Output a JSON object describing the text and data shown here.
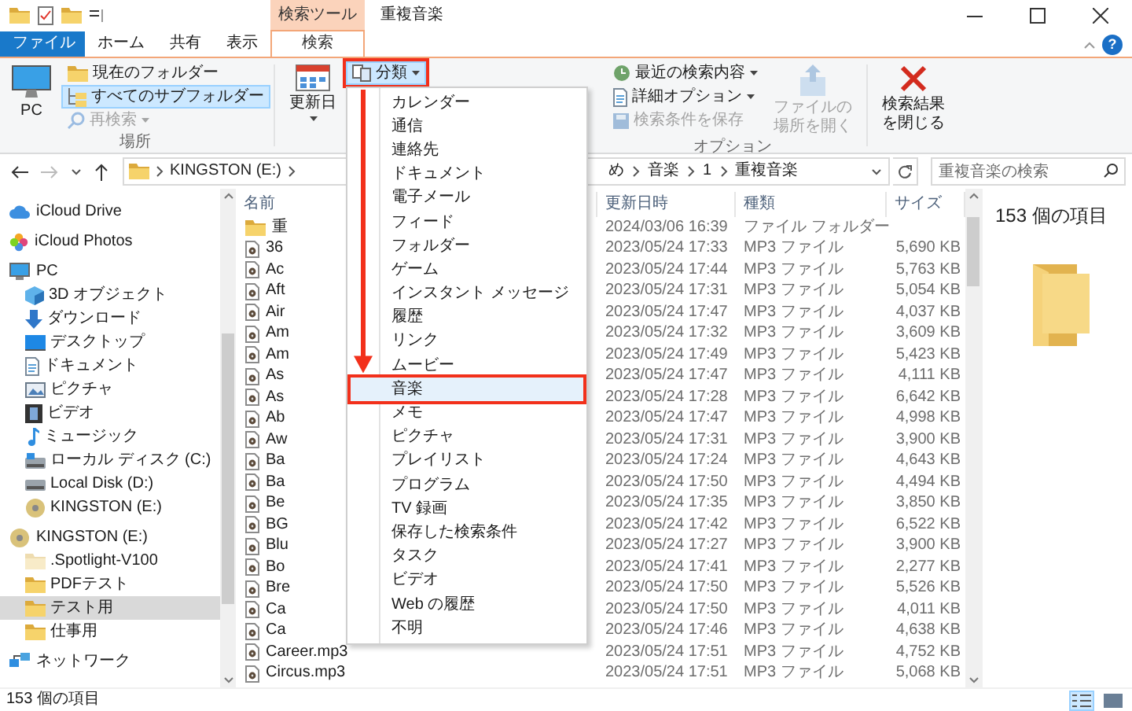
{
  "window": {
    "title": "重複音楽"
  },
  "contextual_tab_group": {
    "label": "検索ツール"
  },
  "tabs": [
    {
      "label": "ファイル",
      "kind": "file",
      "selected": false
    },
    {
      "label": "ホーム",
      "kind": "normal",
      "selected": false
    },
    {
      "label": "共有",
      "kind": "normal",
      "selected": false
    },
    {
      "label": "表示",
      "kind": "normal",
      "selected": false
    },
    {
      "label": "検索",
      "kind": "contextual",
      "selected": true
    }
  ],
  "help_button": {
    "label": "?"
  },
  "ribbon": {
    "location_group": {
      "label": "場所",
      "pc_button": {
        "label": "PC"
      },
      "buttons": [
        {
          "label": "現在のフォルダー",
          "selected": false,
          "disabled": false,
          "dropdown": false
        },
        {
          "label": "すべてのサブフォルダー",
          "selected": true,
          "disabled": false,
          "dropdown": false
        },
        {
          "label": "再検索",
          "selected": false,
          "disabled": true,
          "dropdown": true
        }
      ]
    },
    "date_button": {
      "label": "更新日"
    },
    "kind_button": {
      "label": "分類",
      "pressed": true,
      "highlighted": true
    },
    "options_group": {
      "label": "オプション",
      "buttons": [
        {
          "label": "最近の検索内容",
          "disabled": false,
          "dropdown": true
        },
        {
          "label": "詳細オプション",
          "disabled": false,
          "dropdown": true
        },
        {
          "label": "検索条件を保存",
          "disabled": true,
          "dropdown": false
        }
      ],
      "open_location": {
        "lines": [
          "ファイルの",
          "場所を開く"
        ],
        "disabled": true
      }
    },
    "close_search": {
      "lines": [
        "検索結果",
        "を閉じる"
      ],
      "disabled": false
    }
  },
  "kind_menu": {
    "items": [
      {
        "label": "カレンダー",
        "selected": false,
        "highlighted": false
      },
      {
        "label": "通信",
        "selected": false,
        "highlighted": false
      },
      {
        "label": "連絡先",
        "selected": false,
        "highlighted": false
      },
      {
        "label": "ドキュメント",
        "selected": false,
        "highlighted": false
      },
      {
        "label": "電子メール",
        "selected": false,
        "highlighted": false
      },
      {
        "label": "フィード",
        "selected": false,
        "highlighted": false
      },
      {
        "label": "フォルダー",
        "selected": false,
        "highlighted": false
      },
      {
        "label": "ゲーム",
        "selected": false,
        "highlighted": false
      },
      {
        "label": "インスタント メッセージ",
        "selected": false,
        "highlighted": false
      },
      {
        "label": "履歴",
        "selected": false,
        "highlighted": false
      },
      {
        "label": "リンク",
        "selected": false,
        "highlighted": false
      },
      {
        "label": "ムービー",
        "selected": false,
        "highlighted": false
      },
      {
        "label": "音楽",
        "selected": true,
        "highlighted": true
      },
      {
        "label": "メモ",
        "selected": false,
        "highlighted": false
      },
      {
        "label": "ピクチャ",
        "selected": false,
        "highlighted": false
      },
      {
        "label": "プレイリスト",
        "selected": false,
        "highlighted": false
      },
      {
        "label": "プログラム",
        "selected": false,
        "highlighted": false
      },
      {
        "label": "TV 録画",
        "selected": false,
        "highlighted": false
      },
      {
        "label": "保存した検索条件",
        "selected": false,
        "highlighted": false
      },
      {
        "label": "タスク",
        "selected": false,
        "highlighted": false
      },
      {
        "label": "ビデオ",
        "selected": false,
        "highlighted": false
      },
      {
        "label": "Web の履歴",
        "selected": false,
        "highlighted": false
      },
      {
        "label": "不明",
        "selected": false,
        "highlighted": false
      }
    ]
  },
  "address_bar": {
    "left_segments": [
      "KINGSTON (E:)"
    ],
    "right_segments": [
      "め",
      "音楽",
      "1",
      "重複音楽"
    ]
  },
  "search": {
    "placeholder": "重複音楽の検索"
  },
  "navigation": {
    "items": [
      {
        "label": "iCloud Drive",
        "kind": "cloud",
        "selected": false
      },
      {
        "label": "iCloud Photos",
        "kind": "photos",
        "selected": false
      },
      {
        "label": "PC",
        "kind": "pc",
        "selected": false,
        "children": [
          {
            "label": "3D オブジェクト",
            "kind": "cube",
            "selected": false
          },
          {
            "label": "ダウンロード",
            "kind": "download",
            "selected": false
          },
          {
            "label": "デスクトップ",
            "kind": "desktop",
            "selected": false
          },
          {
            "label": "ドキュメント",
            "kind": "document",
            "selected": false
          },
          {
            "label": "ピクチャ",
            "kind": "pictures",
            "selected": false
          },
          {
            "label": "ビデオ",
            "kind": "video",
            "selected": false
          },
          {
            "label": "ミュージック",
            "kind": "music",
            "selected": false
          },
          {
            "label": "ローカル ディスク (C:)",
            "kind": "system_drive",
            "selected": false
          },
          {
            "label": "Local Disk (D:)",
            "kind": "drive",
            "selected": false
          },
          {
            "label": "KINGSTON (E:)",
            "kind": "usb",
            "selected": false
          }
        ]
      },
      {
        "label": "KINGSTON (E:)",
        "kind": "usb",
        "selected": false,
        "children": [
          {
            "label": ".Spotlight-V100",
            "kind": "hidden_folder",
            "selected": false
          },
          {
            "label": "PDFテスト",
            "kind": "folder",
            "selected": false
          },
          {
            "label": "テスト用",
            "kind": "folder",
            "selected": true
          },
          {
            "label": "仕事用",
            "kind": "folder",
            "selected": false
          }
        ]
      },
      {
        "label": "ネットワーク",
        "kind": "network",
        "selected": false
      }
    ]
  },
  "file_list": {
    "columns": [
      "名前",
      "更新日時",
      "種類",
      "サイズ"
    ],
    "rows": [
      {
        "kind": "folder",
        "name": "重",
        "modified": "2024/03/06 16:39",
        "type": "ファイル フォルダー"
      },
      {
        "kind": "audio",
        "name": "36",
        "modified": "2023/05/24 17:33",
        "type": "MP3 ファイル",
        "size": "5,690 KB"
      },
      {
        "kind": "audio",
        "name": "Ac",
        "modified": "2023/05/24 17:44",
        "type": "MP3 ファイル",
        "size": "5,763 KB"
      },
      {
        "kind": "audio",
        "name": "Aft",
        "modified": "2023/05/24 17:31",
        "type": "MP3 ファイル",
        "size": "5,054 KB"
      },
      {
        "kind": "audio",
        "name": "Air",
        "modified": "2023/05/24 17:47",
        "type": "MP3 ファイル",
        "size": "4,037 KB"
      },
      {
        "kind": "audio",
        "name": "Am",
        "modified": "2023/05/24 17:32",
        "type": "MP3 ファイル",
        "size": "3,609 KB"
      },
      {
        "kind": "audio",
        "name": "Am",
        "modified": "2023/05/24 17:49",
        "type": "MP3 ファイル",
        "size": "5,423 KB"
      },
      {
        "kind": "audio",
        "name": "As",
        "modified": "2023/05/24 17:47",
        "type": "MP3 ファイル",
        "size": "4,111 KB"
      },
      {
        "kind": "audio",
        "name": "As",
        "modified": "2023/05/24 17:28",
        "type": "MP3 ファイル",
        "size": "6,642 KB"
      },
      {
        "kind": "audio",
        "name": "Ab",
        "modified": "2023/05/24 17:47",
        "type": "MP3 ファイル",
        "size": "4,998 KB"
      },
      {
        "kind": "audio",
        "name": "Aw",
        "modified": "2023/05/24 17:31",
        "type": "MP3 ファイル",
        "size": "3,900 KB"
      },
      {
        "kind": "audio",
        "name": "Ba",
        "modified": "2023/05/24 17:24",
        "type": "MP3 ファイル",
        "size": "4,643 KB"
      },
      {
        "kind": "audio",
        "name": "Ba",
        "modified": "2023/05/24 17:50",
        "type": "MP3 ファイル",
        "size": "4,494 KB"
      },
      {
        "kind": "audio",
        "name": "Be",
        "modified": "2023/05/24 17:35",
        "type": "MP3 ファイル",
        "size": "3,850 KB"
      },
      {
        "kind": "audio",
        "name": "BG",
        "modified": "2023/05/24 17:42",
        "type": "MP3 ファイル",
        "size": "6,522 KB"
      },
      {
        "kind": "audio",
        "name": "Blu",
        "modified": "2023/05/24 17:27",
        "type": "MP3 ファイル",
        "size": "3,900 KB"
      },
      {
        "kind": "audio",
        "name": "Bo",
        "modified": "2023/05/24 17:41",
        "type": "MP3 ファイル",
        "size": "2,277 KB"
      },
      {
        "kind": "audio",
        "name": "Bre",
        "modified": "2023/05/24 17:50",
        "type": "MP3 ファイル",
        "size": "5,526 KB"
      },
      {
        "kind": "audio",
        "name": "Ca",
        "modified": "2023/05/24 17:50",
        "type": "MP3 ファイル",
        "size": "4,011 KB"
      },
      {
        "kind": "audio",
        "name": "Ca",
        "modified": "2023/05/24 17:46",
        "type": "MP3 ファイル",
        "size": "4,638 KB"
      },
      {
        "kind": "audio",
        "name": "Career.mp3",
        "modified": "2023/05/24 17:51",
        "type": "MP3 ファイル",
        "size": "4,752 KB"
      },
      {
        "kind": "audio",
        "name": "Circus.mp3",
        "modified": "2023/05/24 17:51",
        "type": "MP3 ファイル",
        "size": "5,068 KB"
      }
    ]
  },
  "preview": {
    "text": "153 個の項目"
  },
  "status_bar": {
    "text": "153 個の項目",
    "views": [
      {
        "kind": "details",
        "selected": true
      },
      {
        "kind": "large_icons",
        "selected": false
      }
    ]
  }
}
